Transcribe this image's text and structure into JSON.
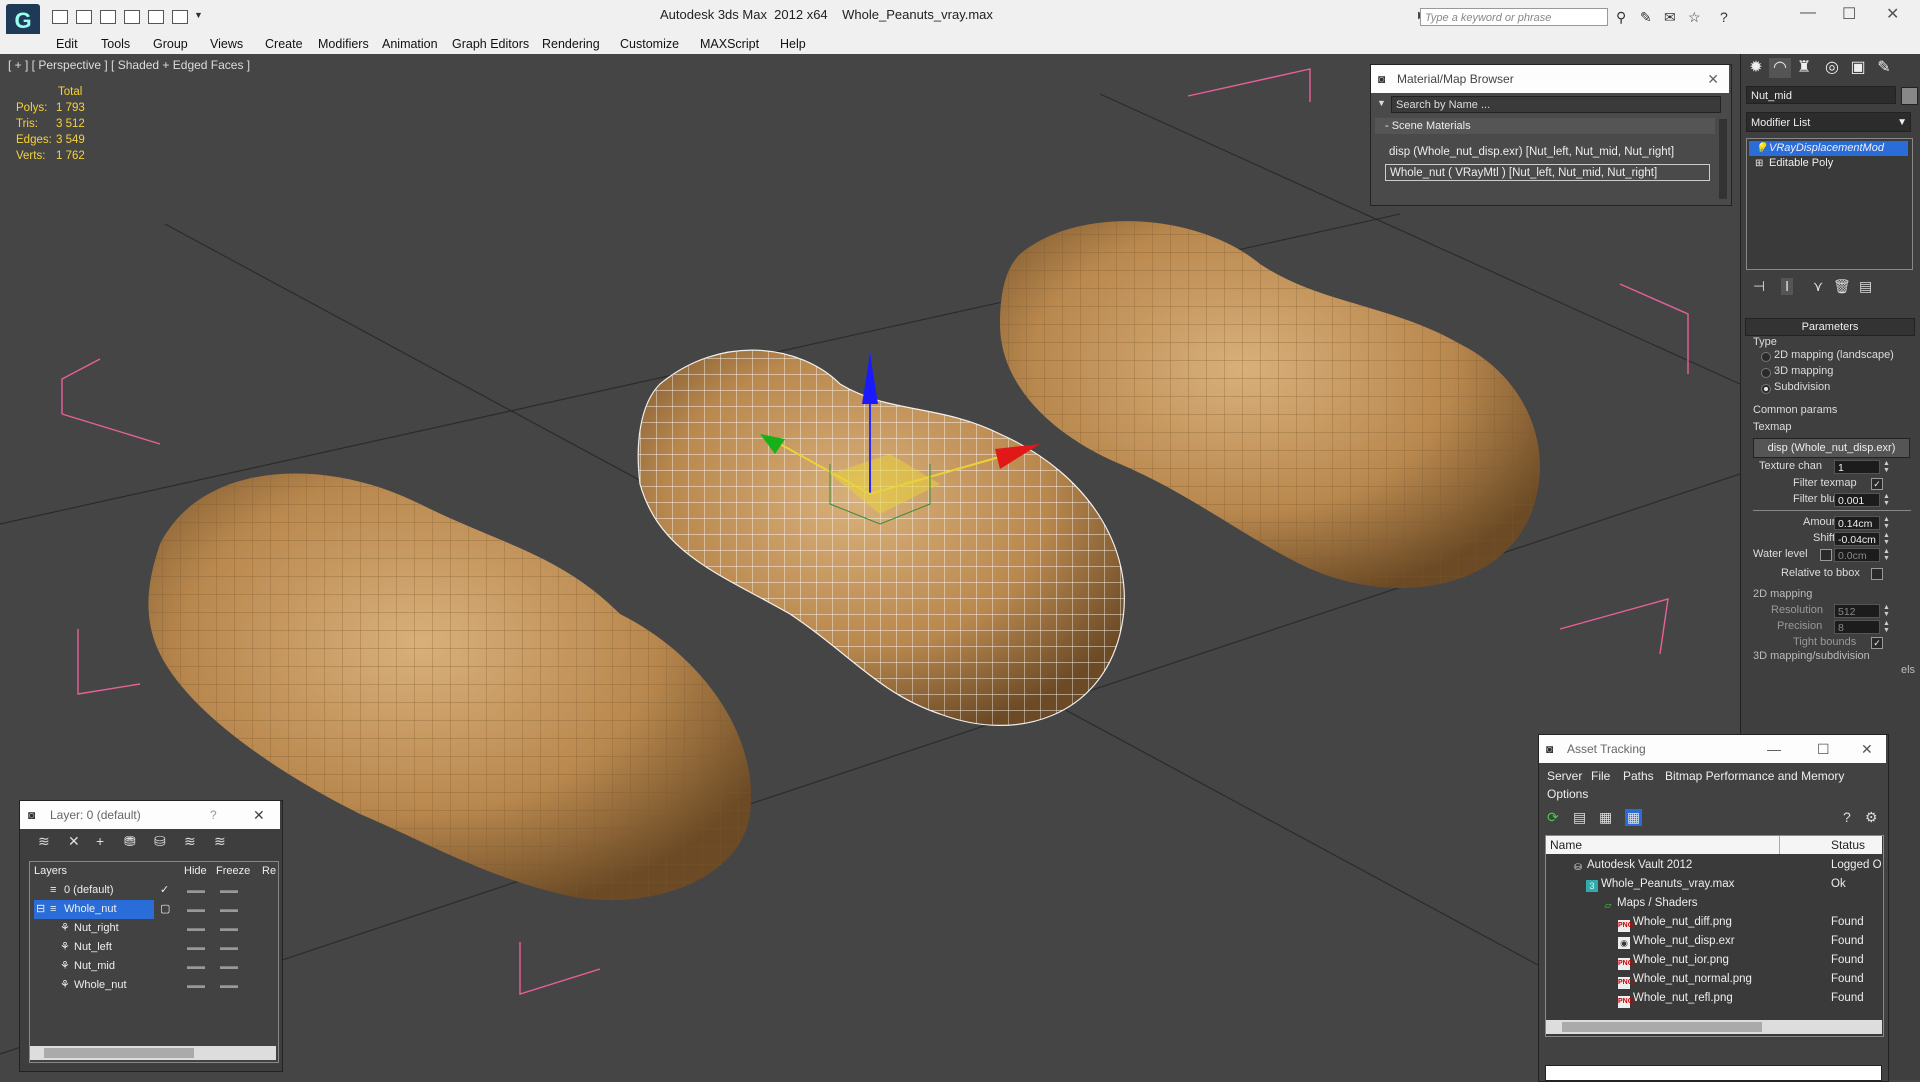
{
  "window": {
    "app_title": "Autodesk 3ds Max  2012 x64",
    "file_name": "Whole_Peanuts_vray.max",
    "search_placeholder": "Type a keyword or phrase"
  },
  "menu": [
    "Edit",
    "Tools",
    "Group",
    "Views",
    "Create",
    "Modifiers",
    "Animation",
    "Graph Editors",
    "Rendering",
    "Customize",
    "MAXScript",
    "Help"
  ],
  "viewport": {
    "label": "[ + ] [ Perspective ] [ Shaded + Edged Faces ]",
    "stats_header": "Total",
    "stats": [
      {
        "key": "Polys:",
        "value": "1 793"
      },
      {
        "key": "Tris:",
        "value": "3 512"
      },
      {
        "key": "Edges:",
        "value": "3 549"
      },
      {
        "key": "Verts:",
        "value": "1 762"
      }
    ]
  },
  "command_panel": {
    "object_name": "Nut_mid",
    "modifier_list": "Modifier List",
    "stack": [
      "VRayDisplacementMod",
      "Editable Poly"
    ],
    "parameters_title": "Parameters",
    "type_label": "Type",
    "type_options": [
      "2D mapping (landscape)",
      "3D mapping",
      "Subdivision"
    ],
    "common_params": "Common params",
    "texmap_label": "Texmap",
    "texmap_value": "disp (Whole_nut_disp.exr)",
    "texture_chan_label": "Texture chan",
    "texture_chan": "1",
    "filter_texmap": "Filter texmap",
    "filter_blur_label": "Filter blur",
    "filter_blur": "0.001",
    "amount_label": "Amount",
    "amount": "0.14cm",
    "shift_label": "Shift",
    "shift": "-0.04cm",
    "water_label": "Water level",
    "water": "0.0cm",
    "relative_bbox": "Relative to bbox",
    "mapping2d": "2D mapping",
    "resolution_label": "Resolution",
    "resolution": "512",
    "precision_label": "Precision",
    "precision": "8",
    "tight_bounds": "Tight bounds",
    "mapping3d": "3D mapping/subdivision",
    "partial_els": "els"
  },
  "material_browser": {
    "title": "Material/Map Browser",
    "search": "Search by Name ...",
    "section": "- Scene Materials",
    "rows": [
      "disp (Whole_nut_disp.exr) [Nut_left, Nut_mid, Nut_right]",
      "Whole_nut  ( VRayMtl )  [Nut_left, Nut_mid, Nut_right]"
    ]
  },
  "layers": {
    "title": "Layer: 0 (default)",
    "help": "?",
    "columns": [
      "Layers",
      "Hide",
      "Freeze",
      "Re"
    ],
    "rows": [
      {
        "name": "0 (default)",
        "indent": 1
      },
      {
        "name": "Whole_nut",
        "indent": 1
      },
      {
        "name": "Nut_right",
        "indent": 2
      },
      {
        "name": "Nut_left",
        "indent": 2
      },
      {
        "name": "Nut_mid",
        "indent": 2
      },
      {
        "name": "Whole_nut",
        "indent": 2
      }
    ]
  },
  "asset_tracking": {
    "title": "Asset Tracking",
    "menu1": [
      "Server",
      "File",
      "Paths",
      "Bitmap Performance and Memory"
    ],
    "menu2": [
      "Options"
    ],
    "columns": [
      "Name",
      "Status"
    ],
    "rows": [
      {
        "name": "Autodesk Vault 2012",
        "status": "Logged O",
        "indent": 1,
        "icon": "vault"
      },
      {
        "name": "Whole_Peanuts_vray.max",
        "status": "Ok",
        "indent": 2,
        "icon": "max"
      },
      {
        "name": "Maps / Shaders",
        "status": "",
        "indent": 3,
        "icon": "folder"
      },
      {
        "name": "Whole_nut_diff.png",
        "status": "Found",
        "indent": 4,
        "icon": "png"
      },
      {
        "name": "Whole_nut_disp.exr",
        "status": "Found",
        "indent": 4,
        "icon": "exr"
      },
      {
        "name": "Whole_nut_ior.png",
        "status": "Found",
        "indent": 4,
        "icon": "png"
      },
      {
        "name": "Whole_nut_normal.png",
        "status": "Found",
        "indent": 4,
        "icon": "png"
      },
      {
        "name": "Whole_nut_refl.png",
        "status": "Found",
        "indent": 4,
        "icon": "png"
      }
    ]
  },
  "colors": {
    "selection": "#2b6dd8",
    "stats": "#f5d23c",
    "viewport_bg": "#454545",
    "bbox": "#e8609a",
    "peanut": "#c79a5e"
  }
}
